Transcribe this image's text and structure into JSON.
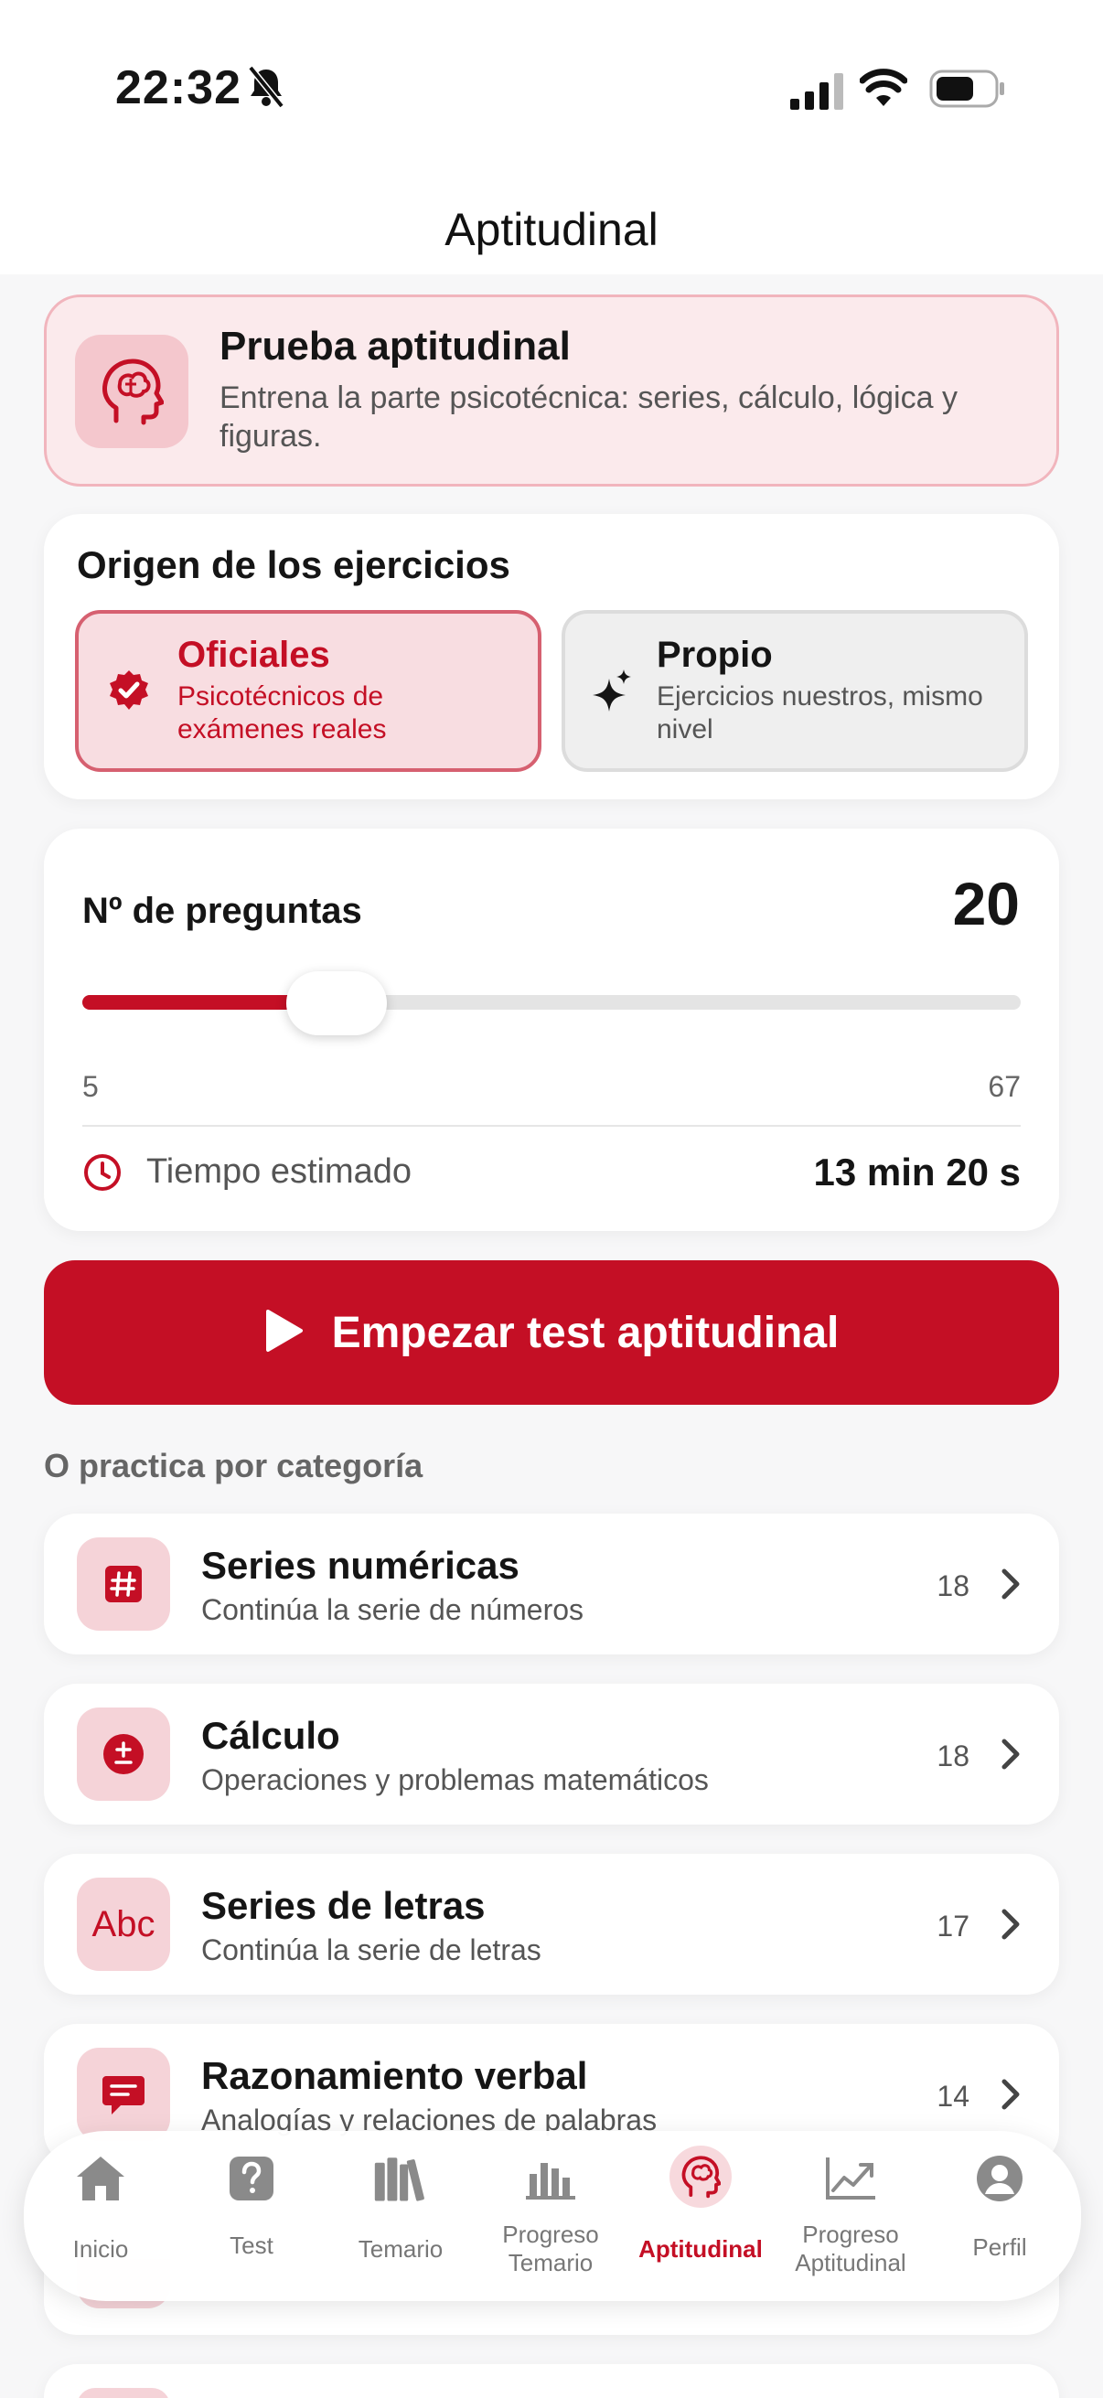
{
  "status_bar": {
    "time": "22:32"
  },
  "header": {
    "title": "Aptitudinal"
  },
  "hero": {
    "title": "Prueba aptitudinal",
    "description": "Entrena la parte psicotécnica: series, cálculo, lógica y figuras.",
    "icon": "brain-head-icon"
  },
  "origin": {
    "title": "Origen de los ejercicios",
    "options": [
      {
        "title": "Oficiales",
        "description": "Psicotécnicos de exámenes reales",
        "selected": true,
        "icon": "verified-badge-icon"
      },
      {
        "title": "Propio",
        "description": "Ejercicios nuestros, mismo nivel",
        "selected": false,
        "icon": "sparkles-icon"
      }
    ]
  },
  "questions": {
    "label": "Nº de preguntas",
    "value": "20",
    "min": "5",
    "max": "67",
    "current": 20,
    "time_label": "Tiempo estimado",
    "time_value": "13 min 20 s"
  },
  "start_button": {
    "label": "Empezar test aptitudinal"
  },
  "categories_heading": "O practica por categoría",
  "categories": [
    {
      "title": "Series numéricas",
      "description": "Continúa la serie de números",
      "count": "18",
      "icon": "hash-icon"
    },
    {
      "title": "Cálculo",
      "description": "Operaciones y problemas matemáticos",
      "count": "18",
      "icon": "plus-minus-icon"
    },
    {
      "title": "Series de letras",
      "description": "Continúa la serie de letras",
      "count": "17",
      "icon": "abc-icon",
      "icon_text": "Abc"
    },
    {
      "title": "Razonamiento verbal",
      "description": "Analogías y relaciones de palabras",
      "count": "14",
      "icon": "chat-bubble-icon"
    }
  ],
  "nav": {
    "items": [
      {
        "label": "Inicio",
        "icon": "home-icon",
        "active": false
      },
      {
        "label": "Test",
        "icon": "question-icon",
        "active": false
      },
      {
        "label": "Temario",
        "icon": "books-icon",
        "active": false
      },
      {
        "label": "Progreso Temario",
        "icon": "bar-chart-icon",
        "active": false
      },
      {
        "label": "Aptitudinal",
        "icon": "brain-head-icon",
        "active": true
      },
      {
        "label": "Progreso Aptitudinal",
        "icon": "trend-chart-icon",
        "active": false
      },
      {
        "label": "Perfil",
        "icon": "profile-icon",
        "active": false
      }
    ]
  },
  "colors": {
    "accent": "#c40f25",
    "accent_light": "#f8dde1",
    "background": "#f7f7f8"
  }
}
